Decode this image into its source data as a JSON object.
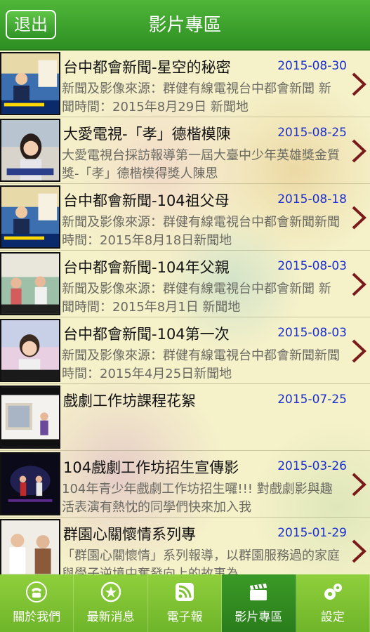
{
  "header": {
    "back_label": "退出",
    "title": "影片專區"
  },
  "videos": [
    {
      "title": "台中都會新聞-星空的秘密",
      "date": "2015-08-30",
      "description": "新聞及影像來源：群健有線電視台中都會新聞 新聞時間：2015年8月29日 新聞地"
    },
    {
      "title": "大愛電視-「孝」德楷模陳",
      "date": "2015-08-25",
      "description": "大愛電視台採訪報導第一屆大臺中少年英雄獎金質獎-「孝」德楷模得獎人陳思"
    },
    {
      "title": "台中都會新聞-104祖父母",
      "date": "2015-08-18",
      "description": "新聞及影像來源：群健有線電視台中都會新聞新聞時間：2015年8月18日新聞地"
    },
    {
      "title": "台中都會新聞-104年父親",
      "date": "2015-08-03",
      "description": "新聞及影像來源：群健有線電視台中都會新聞 新聞時間：2015年8月1日 新聞地"
    },
    {
      "title": "台中都會新聞-104第一次",
      "date": "2015-08-03",
      "description": "新聞及影像來源：群健有線電視台中都會新聞新聞時間：2015年4月25日新聞地"
    },
    {
      "title": "戲劇工作坊課程花絮",
      "date": "2015-07-25",
      "description": ""
    },
    {
      "title": "104戲劇工作坊招生宣傳影",
      "date": "2015-03-26",
      "description": "104年青少年戲劇工作坊招生囉!!! 對戲劇影與趣活表演有熱忱的同學們快來加入我"
    },
    {
      "title": "群園心關懷情系列專",
      "date": "2015-01-29",
      "description": "「群園心關懷情」系列報導，以群園服務過的家庭與學子逆境中奮發向上的故事為"
    }
  ],
  "nav": {
    "items": [
      {
        "label": "關於我們",
        "icon": "phone-icon"
      },
      {
        "label": "最新消息",
        "icon": "star-badge-icon"
      },
      {
        "label": "電子報",
        "icon": "rss-icon"
      },
      {
        "label": "影片專區",
        "icon": "clapperboard-icon"
      },
      {
        "label": "設定",
        "icon": "gears-icon"
      }
    ],
    "active_index": 3
  },
  "colors": {
    "header_green": "#2e8f23",
    "nav_green": "#7cc233",
    "date_blue": "#1a2fd0",
    "chevron": "#7a1a1a"
  }
}
